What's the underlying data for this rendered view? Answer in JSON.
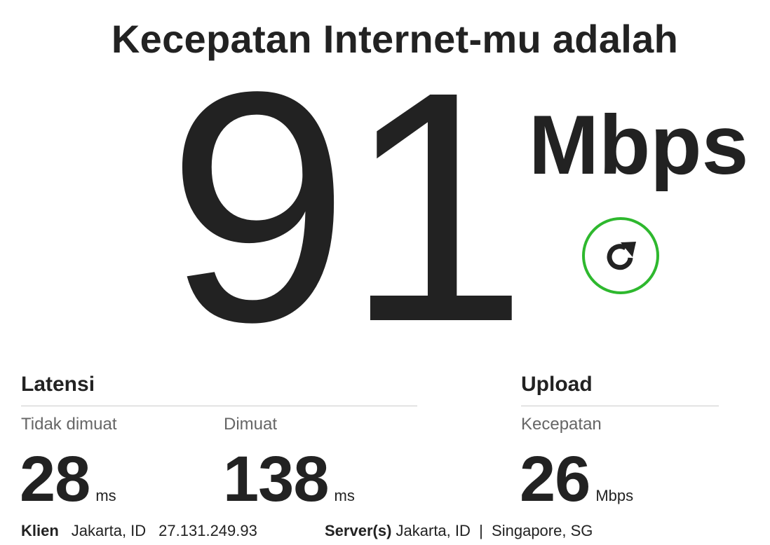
{
  "headline": "Kecepatan Internet-mu adalah",
  "speed": {
    "value": "91",
    "unit": "Mbps"
  },
  "refresh_icon": "refresh-icon",
  "colors": {
    "accent": "#2eb82e",
    "text": "#222222",
    "muted": "#666666",
    "rule": "#cccccc"
  },
  "latency": {
    "title": "Latensi",
    "unloaded": {
      "label": "Tidak dimuat",
      "value": "28",
      "unit": "ms"
    },
    "loaded": {
      "label": "Dimuat",
      "value": "138",
      "unit": "ms"
    }
  },
  "upload": {
    "title": "Upload",
    "speed": {
      "label": "Kecepatan",
      "value": "26",
      "unit": "Mbps"
    }
  },
  "footer": {
    "client_label": "Klien",
    "client_location": "Jakarta, ID",
    "client_ip": "27.131.249.93",
    "server_label": "Server(s)",
    "server_locations": "Jakarta, ID  |  Singapore, SG"
  }
}
